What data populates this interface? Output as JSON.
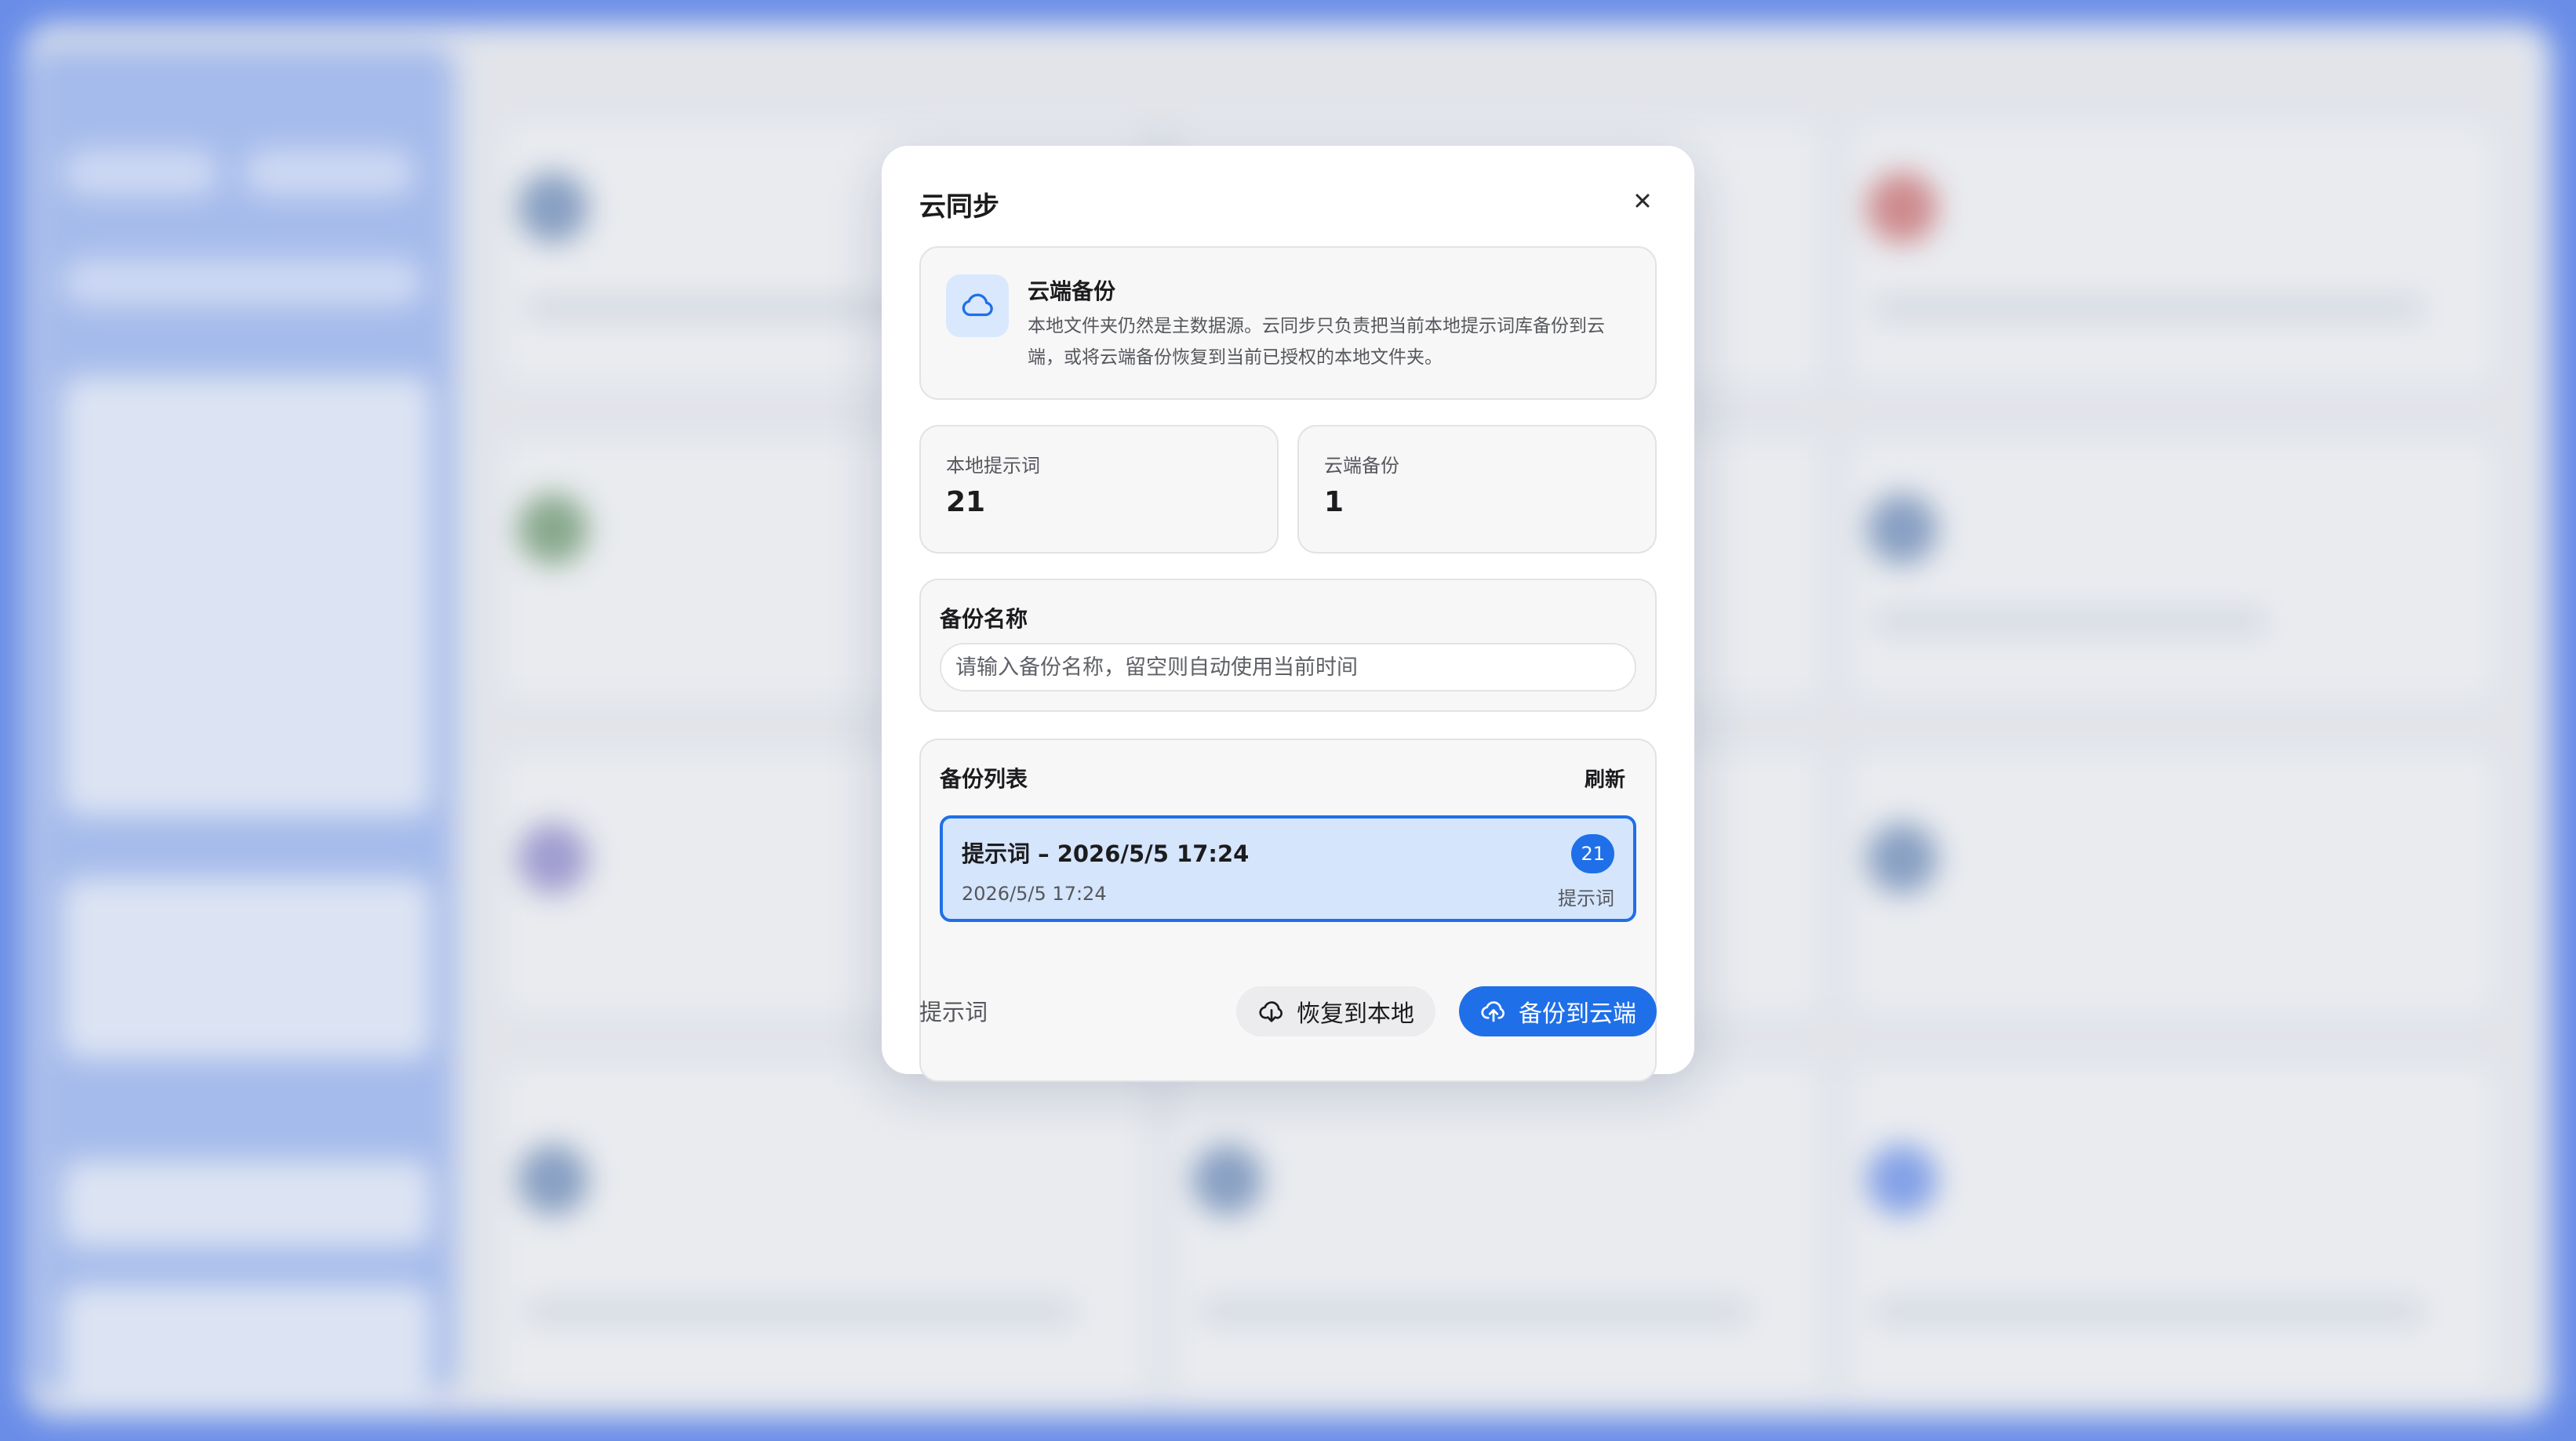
{
  "dialog": {
    "title": "云同步",
    "close_icon": "close-icon"
  },
  "info": {
    "icon": "cloud-icon",
    "title": "云端备份",
    "description": "本地文件夹仍然是主数据源。云同步只负责把当前本地提示词库备份到云端，或将云端备份恢复到当前已授权的本地文件夹。"
  },
  "stats": {
    "local_label": "本地提示词",
    "local_value": "21",
    "cloud_label": "云端备份",
    "cloud_value": "1"
  },
  "backup_name": {
    "label": "备份名称",
    "placeholder": "请输入备份名称，留空则自动使用当前时间",
    "value": ""
  },
  "backup_list": {
    "label": "备份列表",
    "refresh_label": "刷新",
    "items": [
      {
        "title": "提示词 – 2026/5/5 17:24",
        "count": "21",
        "date": "2026/5/5 17:24",
        "type": "提示词",
        "selected": true
      }
    ]
  },
  "footer": {
    "label": "提示词",
    "restore_label": "恢复到本地",
    "restore_icon": "cloud-download-icon",
    "backup_label": "备份到云端",
    "backup_icon": "cloud-upload-icon"
  },
  "colors": {
    "accent": "#1f6fe8",
    "selected_bg": "#d5e5fb",
    "backdrop": "#6f93f0"
  }
}
